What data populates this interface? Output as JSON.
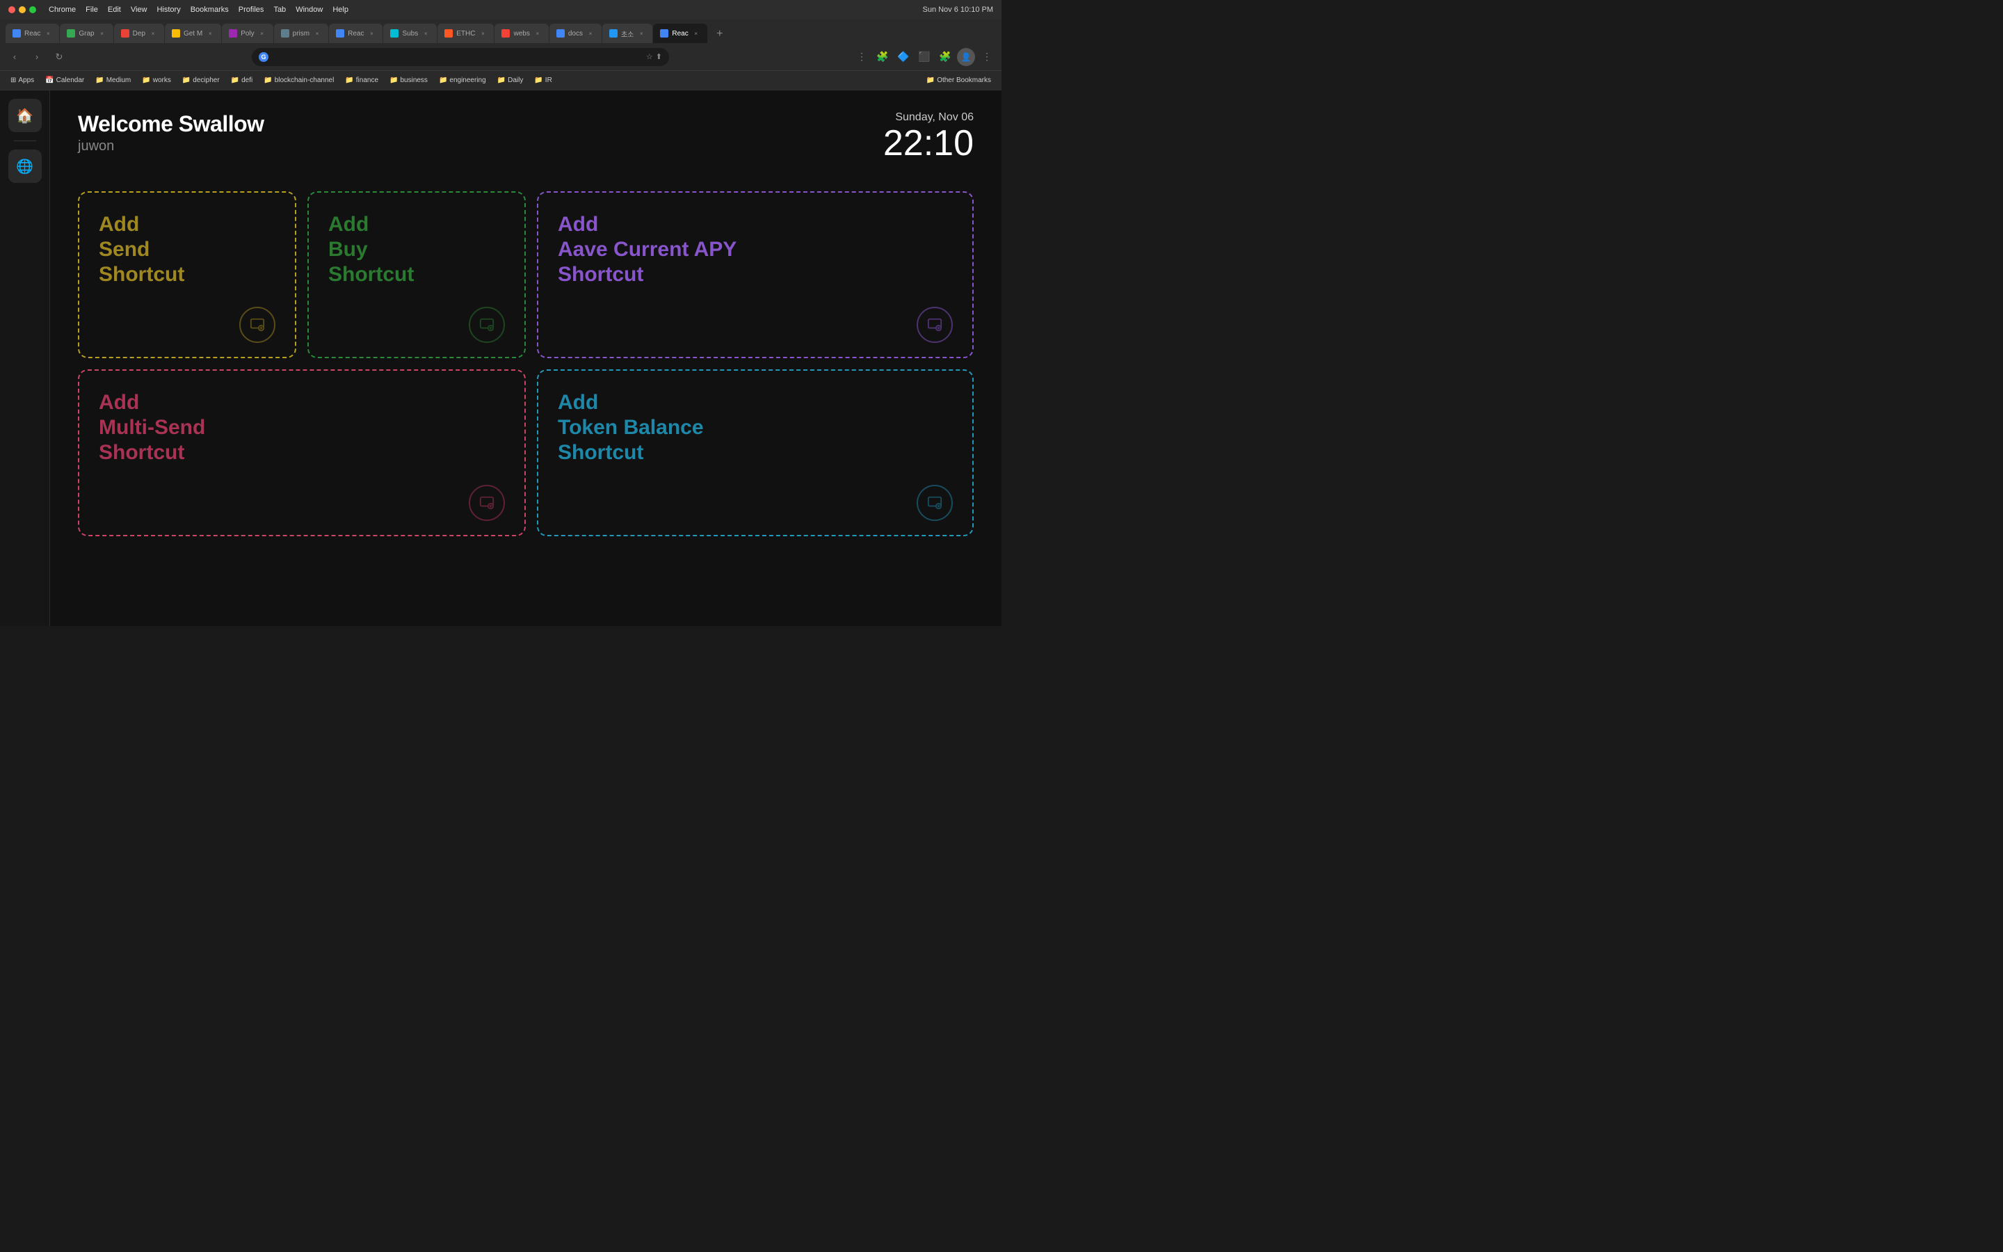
{
  "titlebar": {
    "menu_items": [
      "Chrome",
      "File",
      "Edit",
      "View",
      "History",
      "Bookmarks",
      "Profiles",
      "Tab",
      "Window",
      "Help"
    ],
    "datetime": "Sun Nov 6  10:10 PM"
  },
  "tabs": [
    {
      "label": "Reac",
      "active": false,
      "color": "#4285f4"
    },
    {
      "label": "Grap",
      "active": false,
      "color": "#34a853"
    },
    {
      "label": "Dep",
      "active": false,
      "color": "#ea4335"
    },
    {
      "label": "Get M",
      "active": false,
      "color": "#fbbc05"
    },
    {
      "label": "Poly",
      "active": false,
      "color": "#9c27b0"
    },
    {
      "label": "prism",
      "active": false,
      "color": "#607d8b"
    },
    {
      "label": "Reac",
      "active": false,
      "color": "#4285f4"
    },
    {
      "label": "Subs",
      "active": false,
      "color": "#00bcd4"
    },
    {
      "label": "ETHC",
      "active": false,
      "color": "#ff5722"
    },
    {
      "label": "webs",
      "active": false,
      "color": "#f44336"
    },
    {
      "label": "docs",
      "active": false,
      "color": "#4285f4"
    },
    {
      "label": "초소",
      "active": false,
      "color": "#2196f3"
    },
    {
      "label": "Reac",
      "active": true,
      "color": "#4285f4"
    }
  ],
  "url": "",
  "bookmarks": [
    {
      "label": "Apps",
      "icon": "⊞",
      "type": "apps"
    },
    {
      "label": "Calendar",
      "icon": "📅",
      "type": "folder"
    },
    {
      "label": "Medium",
      "icon": "M",
      "type": "folder"
    },
    {
      "label": "works",
      "icon": "📁",
      "type": "folder"
    },
    {
      "label": "decipher",
      "icon": "📁",
      "type": "folder"
    },
    {
      "label": "defi",
      "icon": "📁",
      "type": "folder"
    },
    {
      "label": "blockchain-channel",
      "icon": "📁",
      "type": "folder"
    },
    {
      "label": "finance",
      "icon": "📁",
      "type": "folder"
    },
    {
      "label": "business",
      "icon": "📁",
      "type": "folder"
    },
    {
      "label": "engineering",
      "icon": "📁",
      "type": "folder"
    },
    {
      "label": "Daily",
      "icon": "📁",
      "type": "folder"
    },
    {
      "label": "IR",
      "icon": "📁",
      "type": "folder"
    },
    {
      "label": "Other Bookmarks",
      "icon": "📁",
      "type": "folder"
    }
  ],
  "page": {
    "welcome_text": "Welcome Swallow",
    "username": "juwon",
    "date": "Sunday, Nov 06",
    "time": "22:10"
  },
  "sidebar": {
    "home_icon": "🏠",
    "globe_icon": "🌐"
  },
  "shortcuts": [
    {
      "id": "card-1",
      "title": "Add\nSend\nShortcut",
      "color": "yellow",
      "icon": "💼"
    },
    {
      "id": "card-2",
      "title": "Add\nBuy\nShortcut",
      "color": "green",
      "icon": "💼"
    },
    {
      "id": "card-3",
      "title": "Add\nAave Current APY\nShortcut",
      "color": "purple",
      "icon": "💼"
    },
    {
      "id": "card-4",
      "title": "Add\nMulti-Send\nShortcut",
      "color": "pink",
      "icon": "💼"
    },
    {
      "id": "card-5",
      "title": "Add\nToken Balance\nShortcut",
      "color": "cyan",
      "icon": "💼"
    }
  ]
}
